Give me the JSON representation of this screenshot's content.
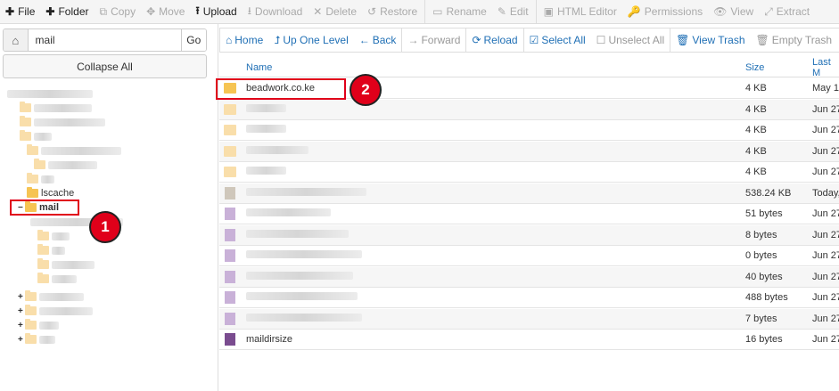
{
  "toolbar": {
    "buttons": [
      {
        "icon": "plus-icon",
        "glyph": "✚",
        "label": "File",
        "enabled": true
      },
      {
        "icon": "plus-icon",
        "glyph": "✚",
        "label": "Folder",
        "enabled": true
      },
      {
        "icon": "copy-icon",
        "glyph": "⧉",
        "label": "Copy",
        "enabled": false
      },
      {
        "icon": "move-icon",
        "glyph": "✥",
        "label": "Move",
        "enabled": false
      },
      {
        "icon": "upload-icon",
        "glyph": "⭱",
        "label": "Upload",
        "enabled": true
      },
      {
        "icon": "download-icon",
        "glyph": "⭳",
        "label": "Download",
        "enabled": false
      },
      {
        "icon": "delete-icon",
        "glyph": "✕",
        "label": "Delete",
        "enabled": false
      },
      {
        "icon": "restore-icon",
        "glyph": "↺",
        "label": "Restore",
        "enabled": false
      },
      {
        "icon": "rename-icon",
        "glyph": "▭",
        "label": "Rename",
        "enabled": false
      },
      {
        "icon": "edit-icon",
        "glyph": "✎",
        "label": "Edit",
        "enabled": false
      },
      {
        "icon": "html-editor-icon",
        "glyph": "▣",
        "label": "HTML Editor",
        "enabled": false
      },
      {
        "icon": "permissions-icon",
        "glyph": "🔑",
        "label": "Permissions",
        "enabled": false
      },
      {
        "icon": "view-icon",
        "glyph": "👁",
        "label": "View",
        "enabled": false
      },
      {
        "icon": "extract-icon",
        "glyph": "⤢",
        "label": "Extract",
        "enabled": false
      }
    ]
  },
  "sidebar": {
    "path_value": "mail",
    "go_label": "Go",
    "collapse_label": "Collapse All",
    "tree": {
      "lscache_label": "lscache",
      "mail_label": "mail",
      "mail_toggle": "−"
    }
  },
  "nav": {
    "buttons": [
      {
        "icon": "home-icon",
        "glyph": "⌂",
        "label": "Home",
        "enabled": true
      },
      {
        "icon": "up-level-icon",
        "glyph": "⮥",
        "label": "Up One Level",
        "enabled": true
      },
      {
        "icon": "back-icon",
        "glyph": "←",
        "label": "Back",
        "enabled": true
      },
      {
        "icon": "forward-icon",
        "glyph": "→",
        "label": "Forward",
        "enabled": false
      },
      {
        "icon": "reload-icon",
        "glyph": "⟳",
        "label": "Reload",
        "enabled": true
      },
      {
        "icon": "select-all-icon",
        "glyph": "☑",
        "label": "Select All",
        "enabled": true
      },
      {
        "icon": "unselect-all-icon",
        "glyph": "☐",
        "label": "Unselect All",
        "enabled": false
      },
      {
        "icon": "trash-icon",
        "glyph": "🗑",
        "label": "View Trash",
        "enabled": true
      },
      {
        "icon": "empty-trash-icon",
        "glyph": "🗑",
        "label": "Empty Trash",
        "enabled": false
      }
    ]
  },
  "table": {
    "columns": {
      "name": "Name",
      "size": "Size",
      "modified": "Last M"
    },
    "rows": [
      {
        "name": "beadwork.co.ke",
        "size": "4 KB",
        "date": "May 1",
        "kind": "folder"
      },
      {
        "name": "",
        "size": "4 KB",
        "date": "Jun 27",
        "kind": "folder-dim"
      },
      {
        "name": "",
        "size": "4 KB",
        "date": "Jun 27",
        "kind": "folder-dim"
      },
      {
        "name": "",
        "size": "4 KB",
        "date": "Jun 27",
        "kind": "folder-dim"
      },
      {
        "name": "",
        "size": "4 KB",
        "date": "Jun 27",
        "kind": "folder-dim"
      },
      {
        "name": "",
        "size": "538.24 KB",
        "date": "Today,",
        "kind": "file-gray"
      },
      {
        "name": "",
        "size": "51 bytes",
        "date": "Jun 27",
        "kind": "file-purple"
      },
      {
        "name": "",
        "size": "8 bytes",
        "date": "Jun 27",
        "kind": "file-purple"
      },
      {
        "name": "",
        "size": "0 bytes",
        "date": "Jun 27",
        "kind": "file-purple"
      },
      {
        "name": "",
        "size": "40 bytes",
        "date": "Jun 27",
        "kind": "file-purple"
      },
      {
        "name": "",
        "size": "488 bytes",
        "date": "Jun 27",
        "kind": "file-purple"
      },
      {
        "name": "",
        "size": "7 bytes",
        "date": "Jun 27",
        "kind": "file-purple"
      },
      {
        "name": "maildirsize",
        "size": "16 bytes",
        "date": "Jun 27",
        "kind": "file-purple-solid"
      }
    ]
  },
  "annotations": {
    "badge1": "1",
    "badge2": "2"
  },
  "colors": {
    "callout": "#e0001a",
    "link": "#1f6fb5",
    "folder": "#f6c453"
  }
}
